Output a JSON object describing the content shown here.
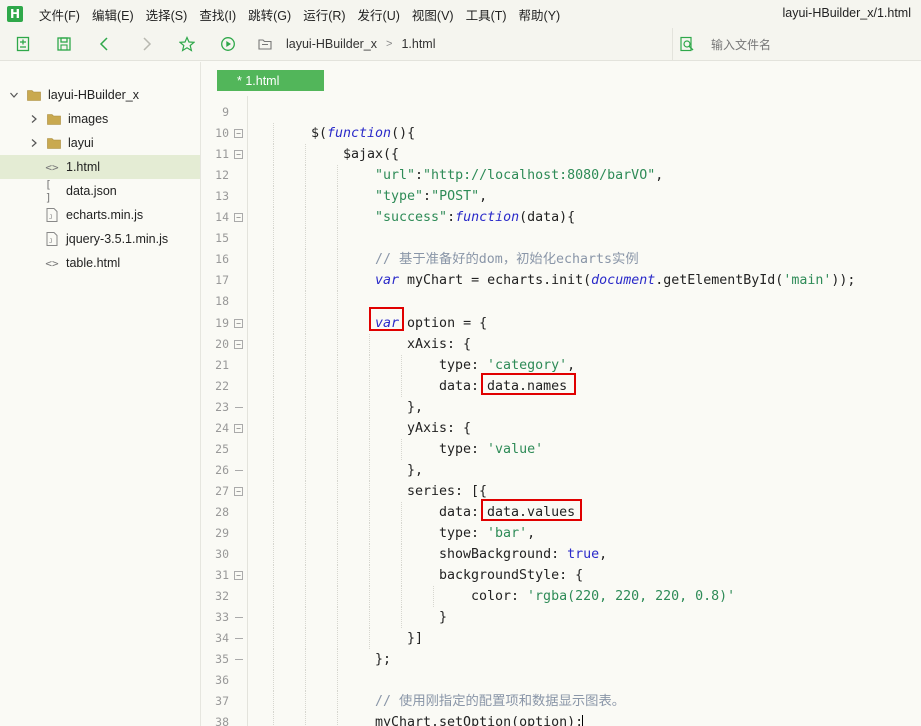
{
  "window": {
    "title": "layui-HBuilder_x/1.html",
    "logo_letter": "H"
  },
  "menu": [
    "文件(F)",
    "编辑(E)",
    "选择(S)",
    "查找(I)",
    "跳转(G)",
    "运行(R)",
    "发行(U)",
    "视图(V)",
    "工具(T)",
    "帮助(Y)"
  ],
  "toolbar": {
    "breadcrumb": [
      "layui-HBuilder_x",
      "1.html"
    ],
    "search_placeholder": "输入文件名"
  },
  "sidebar": {
    "items": [
      {
        "label": "layui-HBuilder_x",
        "type": "folder",
        "expanded": true,
        "level": 0
      },
      {
        "label": "images",
        "type": "folder",
        "expanded": false,
        "level": 1
      },
      {
        "label": "layui",
        "type": "folder",
        "expanded": false,
        "level": 1
      },
      {
        "label": "1.html",
        "type": "html",
        "selected": true,
        "level": 1
      },
      {
        "label": "data.json",
        "type": "json",
        "level": 1
      },
      {
        "label": "echarts.min.js",
        "type": "js",
        "level": 1
      },
      {
        "label": "jquery-3.5.1.min.js",
        "type": "js",
        "level": 1
      },
      {
        "label": "table.html",
        "type": "html",
        "level": 1
      }
    ]
  },
  "editor": {
    "tab_label": "* 1.html",
    "lines": [
      {
        "n": "9",
        "fold": "",
        "indent": 0,
        "tokens": []
      },
      {
        "n": "10",
        "fold": "open",
        "indent": 2,
        "tokens": [
          [
            "pl",
            "$("
          ],
          [
            "kw",
            "function"
          ],
          [
            "pl",
            "(){"
          ]
        ]
      },
      {
        "n": "11",
        "fold": "open",
        "indent": 3,
        "tokens": [
          [
            "pl",
            "$ajax({"
          ]
        ]
      },
      {
        "n": "12",
        "fold": "",
        "indent": 4,
        "tokens": [
          [
            "str",
            "\"url\""
          ],
          [
            "pl",
            ":"
          ],
          [
            "str",
            "\"http://localhost:8080/barVO\""
          ],
          [
            "pl",
            ","
          ]
        ]
      },
      {
        "n": "13",
        "fold": "",
        "indent": 4,
        "tokens": [
          [
            "str",
            "\"type\""
          ],
          [
            "pl",
            ":"
          ],
          [
            "str",
            "\"POST\""
          ],
          [
            "pl",
            ","
          ]
        ]
      },
      {
        "n": "14",
        "fold": "open",
        "indent": 4,
        "tokens": [
          [
            "str",
            "\"success\""
          ],
          [
            "pl",
            ":"
          ],
          [
            "kw",
            "function"
          ],
          [
            "pl",
            "(data){"
          ]
        ]
      },
      {
        "n": "15",
        "fold": "",
        "indent": 4,
        "tokens": []
      },
      {
        "n": "16",
        "fold": "",
        "indent": 4,
        "tokens": [
          [
            "cm",
            "// 基于准备好的dom，初始化echarts实例"
          ]
        ]
      },
      {
        "n": "17",
        "fold": "",
        "indent": 4,
        "tokens": [
          [
            "kw",
            "var"
          ],
          [
            "pl",
            " myChart = echarts.init("
          ],
          [
            "kw",
            "document"
          ],
          [
            "pl",
            ".getElementById("
          ],
          [
            "str",
            "'main'"
          ],
          [
            "pl",
            "));"
          ]
        ]
      },
      {
        "n": "18",
        "fold": "",
        "indent": 4,
        "tokens": []
      },
      {
        "n": "19",
        "fold": "open",
        "indent": 4,
        "tokens": [
          [
            "kw",
            "var"
          ],
          [
            "pl",
            " option = {"
          ]
        ]
      },
      {
        "n": "20",
        "fold": "open",
        "indent": 5,
        "tokens": [
          [
            "pl",
            "xAxis: {"
          ]
        ]
      },
      {
        "n": "21",
        "fold": "",
        "indent": 6,
        "tokens": [
          [
            "pl",
            "type: "
          ],
          [
            "str",
            "'category'"
          ],
          [
            "pl",
            ","
          ]
        ]
      },
      {
        "n": "22",
        "fold": "",
        "indent": 6,
        "tokens": [
          [
            "pl",
            "data: data.names"
          ]
        ]
      },
      {
        "n": "23",
        "fold": "end",
        "indent": 5,
        "tokens": [
          [
            "pl",
            "},"
          ]
        ]
      },
      {
        "n": "24",
        "fold": "open",
        "indent": 5,
        "tokens": [
          [
            "pl",
            "yAxis: {"
          ]
        ]
      },
      {
        "n": "25",
        "fold": "",
        "indent": 6,
        "tokens": [
          [
            "pl",
            "type: "
          ],
          [
            "str",
            "'value'"
          ]
        ]
      },
      {
        "n": "26",
        "fold": "end",
        "indent": 5,
        "tokens": [
          [
            "pl",
            "},"
          ]
        ]
      },
      {
        "n": "27",
        "fold": "open",
        "indent": 5,
        "tokens": [
          [
            "pl",
            "series: [{"
          ]
        ]
      },
      {
        "n": "28",
        "fold": "",
        "indent": 6,
        "tokens": [
          [
            "pl",
            "data: data.values"
          ]
        ]
      },
      {
        "n": "29",
        "fold": "",
        "indent": 6,
        "tokens": [
          [
            "pl",
            "type: "
          ],
          [
            "str",
            "'bar'"
          ],
          [
            "pl",
            ","
          ]
        ]
      },
      {
        "n": "30",
        "fold": "",
        "indent": 6,
        "tokens": [
          [
            "pl",
            "showBackground: "
          ],
          [
            "bool",
            "true"
          ],
          [
            "pl",
            ","
          ]
        ]
      },
      {
        "n": "31",
        "fold": "open",
        "indent": 6,
        "tokens": [
          [
            "pl",
            "backgroundStyle: {"
          ]
        ]
      },
      {
        "n": "32",
        "fold": "",
        "indent": 7,
        "tokens": [
          [
            "pl",
            "color: "
          ],
          [
            "str",
            "'rgba(220, 220, 220, 0.8)'"
          ]
        ]
      },
      {
        "n": "33",
        "fold": "end",
        "indent": 6,
        "tokens": [
          [
            "pl",
            "}"
          ]
        ]
      },
      {
        "n": "34",
        "fold": "end",
        "indent": 5,
        "tokens": [
          [
            "pl",
            "}]"
          ]
        ]
      },
      {
        "n": "35",
        "fold": "end",
        "indent": 4,
        "tokens": [
          [
            "pl",
            "};"
          ]
        ]
      },
      {
        "n": "36",
        "fold": "",
        "indent": 4,
        "tokens": []
      },
      {
        "n": "37",
        "fold": "",
        "indent": 4,
        "tokens": [
          [
            "cm",
            "// 使用刚指定的配置项和数据显示图表。"
          ]
        ]
      },
      {
        "n": "38",
        "fold": "",
        "indent": 4,
        "tokens": [
          [
            "pl",
            "myChart.setOption(option);"
          ]
        ]
      }
    ]
  },
  "colors": {
    "accent_green": "#52b65a",
    "highlight_red": "#e00000",
    "keyword_blue": "#2a2ac9",
    "string_green": "#2e8b57",
    "comment_gray": "#8a96a8"
  }
}
